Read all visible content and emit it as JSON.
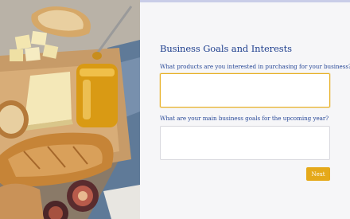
{
  "progress": {
    "fraction": 0.33
  },
  "form": {
    "title": "Business Goals and Interests",
    "questions": [
      {
        "label": "What products are you interested in purchasing for your business?",
        "value": ""
      },
      {
        "label": "What are your main business goals for the upcoming year?",
        "value": ""
      }
    ],
    "next_label": "Next"
  },
  "colors": {
    "accent": "#e5a91a",
    "heading": "#1f3f8e",
    "progress_track": "#c9cde8"
  },
  "image": {
    "subject": "bread-cheese-honey-figs-photo"
  }
}
